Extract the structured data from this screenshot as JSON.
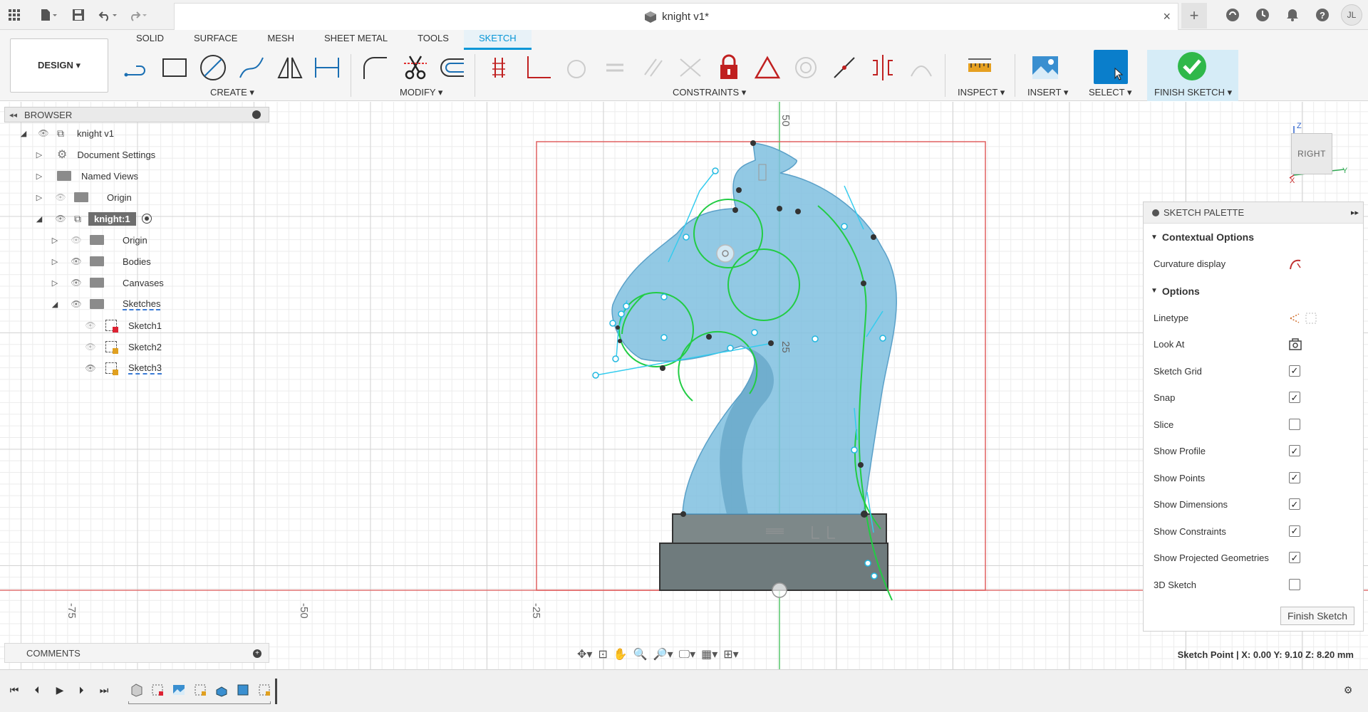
{
  "title_bar": {
    "document_title": "knight v1*",
    "close_tab": "×",
    "new_tab": "+",
    "user_initials": "JL"
  },
  "ribbon": {
    "workspace_button": "DESIGN ▾",
    "tabs": [
      {
        "label": "SOLID",
        "active": false
      },
      {
        "label": "SURFACE",
        "active": false
      },
      {
        "label": "MESH",
        "active": false
      },
      {
        "label": "SHEET METAL",
        "active": false
      },
      {
        "label": "TOOLS",
        "active": false
      },
      {
        "label": "SKETCH",
        "active": true
      }
    ],
    "groups": {
      "create": "CREATE ▾",
      "modify": "MODIFY ▾",
      "constraints": "CONSTRAINTS ▾",
      "inspect": "INSPECT ▾",
      "insert": "INSERT ▾",
      "select": "SELECT ▾",
      "finish_sketch": "FINISH SKETCH ▾"
    }
  },
  "browser": {
    "header": "BROWSER",
    "items": [
      {
        "label": "knight v1",
        "level": 0,
        "expanded": true
      },
      {
        "label": "Document Settings",
        "level": 1
      },
      {
        "label": "Named Views",
        "level": 1
      },
      {
        "label": "Origin",
        "level": 1
      },
      {
        "label": "knight:1",
        "level": 1,
        "expanded": true
      },
      {
        "label": "Origin",
        "level": 2
      },
      {
        "label": "Bodies",
        "level": 2
      },
      {
        "label": "Canvases",
        "level": 2
      },
      {
        "label": "Sketches",
        "level": 2,
        "expanded": true
      },
      {
        "label": "Sketch1",
        "level": 3
      },
      {
        "label": "Sketch2",
        "level": 3
      },
      {
        "label": "Sketch3",
        "level": 3
      }
    ]
  },
  "comments": {
    "label": "COMMENTS"
  },
  "canvas": {
    "axis_labels": {
      "top_50": "50",
      "mid_25": "25",
      "bottom_minus75": "-75",
      "bottom_minus50": "-50",
      "bottom_minus25": "-25"
    },
    "viewcube_face": "RIGHT"
  },
  "sketch_palette": {
    "title": "SKETCH PALETTE",
    "section_contextual": "Contextual Options",
    "curvature_display": "Curvature display",
    "section_options": "Options",
    "options": [
      {
        "label": "Linetype",
        "type": "icon"
      },
      {
        "label": "Look At",
        "type": "icon"
      },
      {
        "label": "Sketch Grid",
        "type": "checkbox",
        "checked": true
      },
      {
        "label": "Snap",
        "type": "checkbox",
        "checked": true
      },
      {
        "label": "Slice",
        "type": "checkbox",
        "checked": false
      },
      {
        "label": "Show Profile",
        "type": "checkbox",
        "checked": true
      },
      {
        "label": "Show Points",
        "type": "checkbox",
        "checked": true
      },
      {
        "label": "Show Dimensions",
        "type": "checkbox",
        "checked": true
      },
      {
        "label": "Show Constraints",
        "type": "checkbox",
        "checked": true
      },
      {
        "label": "Show Projected Geometries",
        "type": "checkbox",
        "checked": true
      },
      {
        "label": "3D Sketch",
        "type": "checkbox",
        "checked": false
      }
    ],
    "finish_button": "Finish Sketch"
  },
  "status_bar": {
    "readout": "Sketch Point | X: 0.00 Y: 9.10 Z: 8.20 mm"
  },
  "colors": {
    "accent": "#0696d7",
    "sketch_profile": "#7fbfdf",
    "green_curve": "#22cc44",
    "red_bounds": "#e05050",
    "base_grey": "#6f7b7d"
  }
}
